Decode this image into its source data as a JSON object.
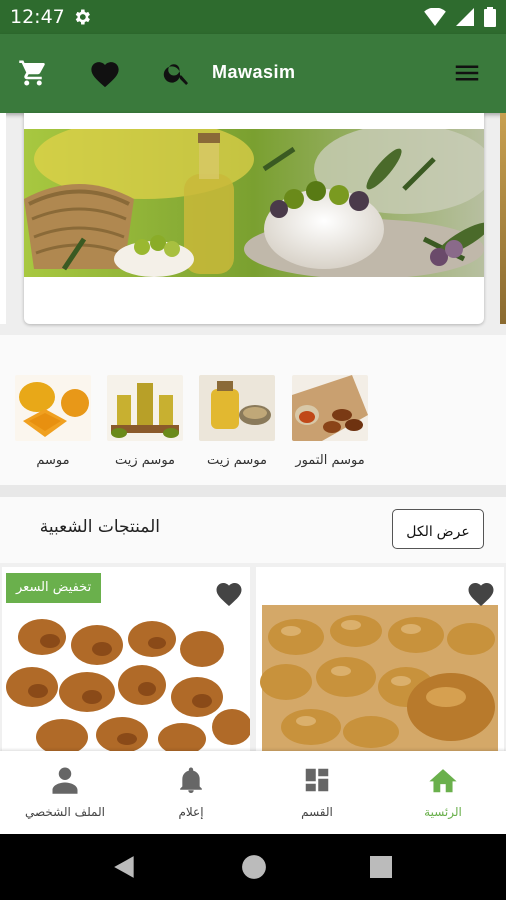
{
  "status_bar": {
    "time": "12:47"
  },
  "app_bar": {
    "title": "Mawasim"
  },
  "categories": [
    {
      "label": "موسم التمور"
    },
    {
      "label": "موسم زيت"
    },
    {
      "label": "موسم زيت"
    },
    {
      "label": "موسم"
    }
  ],
  "popular": {
    "title": "المنتجات الشعبية",
    "view_all": "عرض الكل"
  },
  "products": [
    {
      "badge": "تخفيض السعر"
    }
  ],
  "bottom_nav": {
    "items": [
      {
        "label": "الرئسية"
      },
      {
        "label": "القسم"
      },
      {
        "label": "إعلام"
      },
      {
        "label": "الملف الشخصي"
      }
    ]
  },
  "colors": {
    "primary": "#3a7a3c",
    "status": "#2e6b2e",
    "accent": "#6ab04c"
  }
}
